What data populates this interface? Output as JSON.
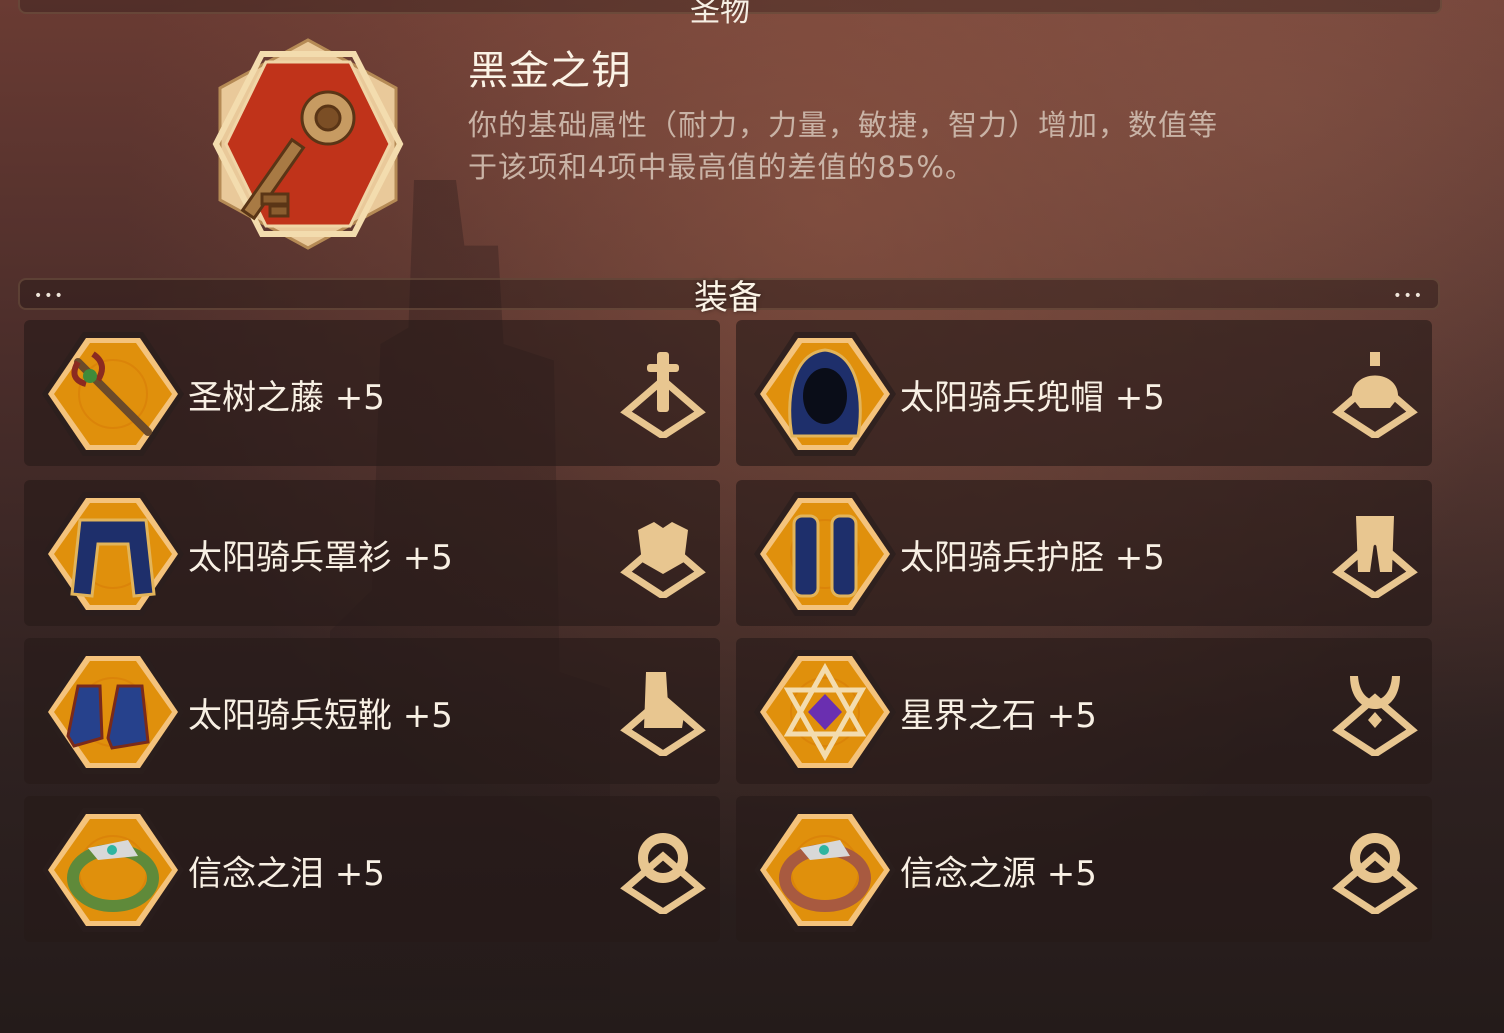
{
  "header": {
    "title": "圣物"
  },
  "relic": {
    "name": "黑金之钥",
    "description_line1": "你的基础属性（耐力，力量，敏捷，智力）增加，数值等",
    "description_line2": "于该项和4项中最高值的差值的85%。",
    "icon": "black-gold-key-icon"
  },
  "equipment_section": {
    "title": "装备",
    "dots": "•••"
  },
  "equipment": [
    {
      "name": "圣树之藤 +5",
      "icon": "vine-staff-icon",
      "slot_icon": "weapon-slot-icon"
    },
    {
      "name": "太阳骑兵兜帽 +5",
      "icon": "hood-icon",
      "slot_icon": "helmet-slot-icon"
    },
    {
      "name": "太阳骑兵罩衫 +5",
      "icon": "robe-icon",
      "slot_icon": "chest-slot-icon"
    },
    {
      "name": "太阳骑兵护胫 +5",
      "icon": "greaves-icon",
      "slot_icon": "legs-slot-icon"
    },
    {
      "name": "太阳骑兵短靴 +5",
      "icon": "boots-icon",
      "slot_icon": "boots-slot-icon"
    },
    {
      "name": "星界之石 +5",
      "icon": "astral-stone-icon",
      "slot_icon": "amulet-slot-icon"
    },
    {
      "name": "信念之泪 +5",
      "icon": "green-ring-icon",
      "slot_icon": "ring-slot-icon"
    },
    {
      "name": "信念之源 +5",
      "icon": "copper-ring-icon",
      "slot_icon": "ring-slot-icon"
    }
  ],
  "colors": {
    "badge_orange": "#e0900c",
    "badge_gold_rim": "#f2c27a",
    "relic_red": "#c0331a",
    "slot_gold": "#e8c690"
  }
}
